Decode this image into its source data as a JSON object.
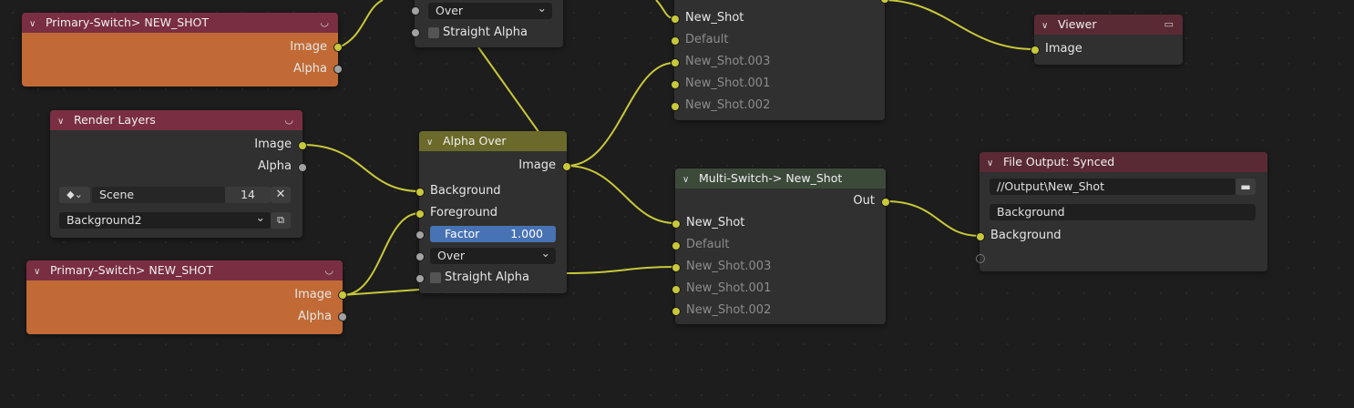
{
  "wire_color": "#c8c83a",
  "group_top": {
    "title": "Primary-Switch> NEW_SHOT",
    "outputs": [
      "Image",
      "Alpha"
    ]
  },
  "top_partial": {
    "blend_mode": "Over",
    "straight_alpha": "Straight Alpha"
  },
  "render_layers": {
    "title": "Render Layers",
    "outputs": [
      "Image",
      "Alpha"
    ],
    "scene_icon": "scene-icon",
    "scene": "Scene",
    "scene_users": "14",
    "layer": "Background2"
  },
  "group_bottom": {
    "title": "Primary-Switch> NEW_SHOT",
    "outputs": [
      "Image",
      "Alpha"
    ]
  },
  "alpha_over": {
    "title": "Alpha Over",
    "output": "Image",
    "inputs": [
      "Background",
      "Foreground"
    ],
    "factor_label": "Factor",
    "factor_value": "1.000",
    "blend_mode": "Over",
    "straight_alpha": "Straight Alpha"
  },
  "switch_top": {
    "inputs": [
      "New_Shot",
      "Default",
      "New_Shot.003",
      "New_Shot.001",
      "New_Shot.002"
    ]
  },
  "multi_switch": {
    "title": "Multi-Switch-> New_Shot",
    "output": "Out",
    "inputs": [
      "New_Shot",
      "Default",
      "New_Shot.003",
      "New_Shot.001",
      "New_Shot.002"
    ]
  },
  "viewer": {
    "title": "Viewer",
    "icon": "monitor-icon",
    "input": "Image"
  },
  "file_output": {
    "title": "File Output: Synced",
    "path": "//Output\\New_Shot",
    "layer_name": "Background",
    "input": "Background"
  }
}
